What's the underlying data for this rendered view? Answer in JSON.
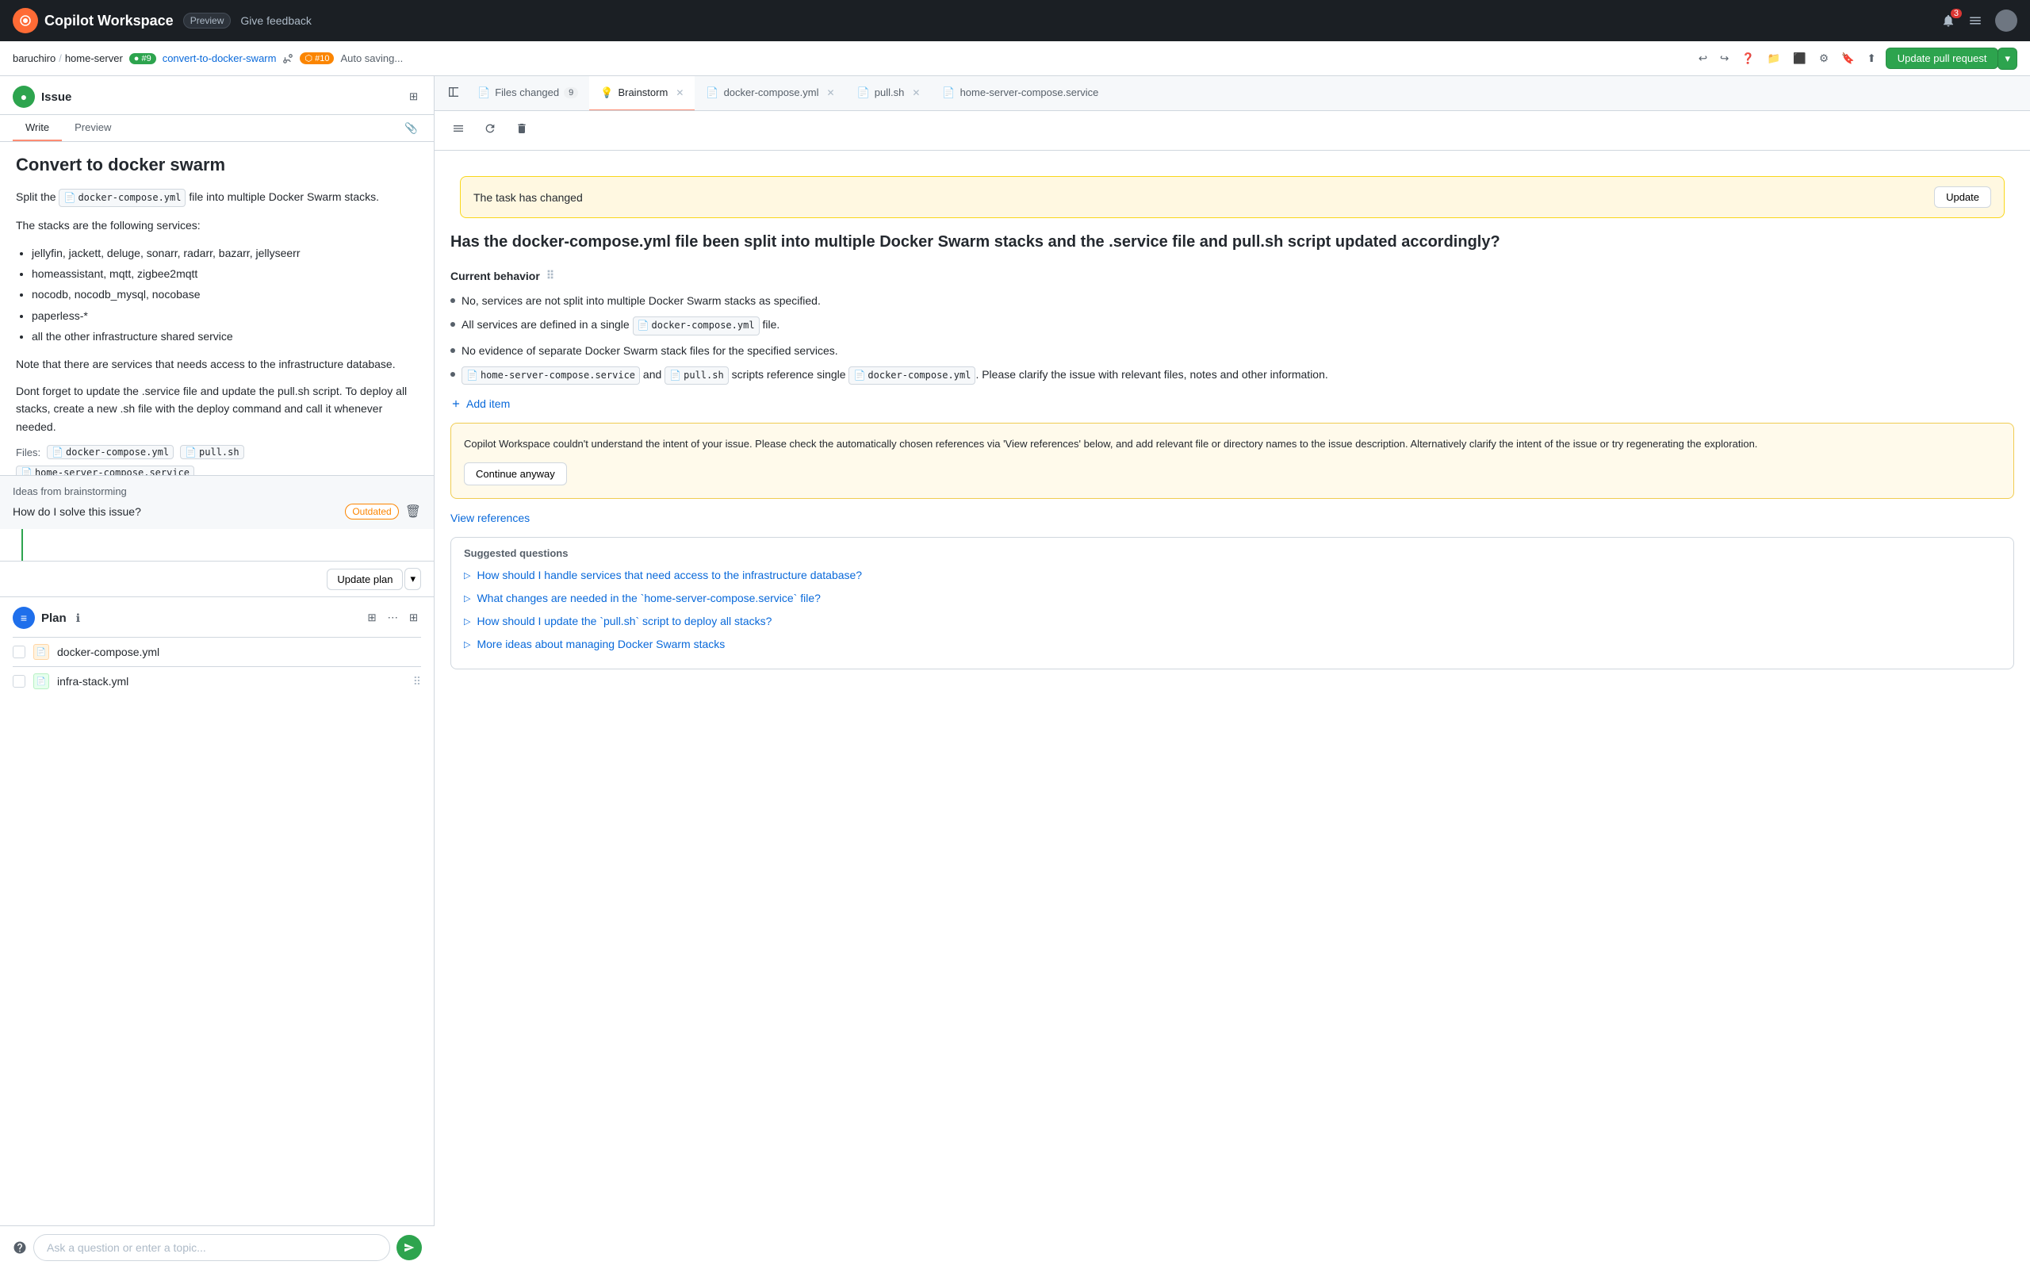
{
  "topNav": {
    "title": "Copilot Workspace",
    "badge": "Preview",
    "feedback": "Give feedback",
    "bellCount": "3",
    "icons": {
      "bell": "🔔",
      "menu": "☰",
      "avatar": ""
    }
  },
  "secondaryNav": {
    "user": "baruchiro",
    "repo": "home-server",
    "issueNum": "#9",
    "branch": "convert-to-docker-swarm",
    "prNum": "#10",
    "autoSaving": "Auto saving...",
    "updatePR": "Update pull request"
  },
  "leftPanel": {
    "issueLabel": "Issue",
    "tabs": {
      "write": "Write",
      "preview": "Preview"
    },
    "issueTitle": "Convert to docker swarm",
    "issueBody": [
      "Split the",
      "docker-compose.yml",
      "file into multiple Docker Swarm stacks.",
      "The stacks are the following services:"
    ],
    "stacksList": [
      "jellyfin, jackett, deluge, sonarr, radarr, bazarr, jellyseerr",
      "homeassistant, mqtt, zigbee2mqtt",
      "nocodb, nocodb_mysql, nocobase",
      "paperless-*",
      "all the other infrastructure shared service"
    ],
    "noteParagraph": "Note that there are services that needs access to the infrastructure database.",
    "deployParagraph": "Dont forget to update the .service file and update the pull.sh script. To deploy all stacks, create a new .sh file with the deploy command and call it whenever needed.",
    "filesLabel": "Files:",
    "files": [
      "docker-compose.yml",
      "pull.sh",
      "home-server-compose.service"
    ],
    "ideasSection": {
      "label": "Ideas from brainstorming",
      "item": "How do I solve this issue?",
      "outdatedBadge": "Outdated"
    },
    "updatePlanBtn": "Update plan",
    "planLabel": "Plan",
    "planItems": [
      {
        "name": "docker-compose.yml",
        "type": "orange",
        "icon": "📄"
      },
      {
        "name": "infra-stack.yml",
        "type": "green",
        "icon": "📄"
      }
    ]
  },
  "askBar": {
    "placeholder": "Ask a question or enter a topic...",
    "sendIcon": "▶"
  },
  "rightPanel": {
    "tabs": [
      {
        "id": "files-changed",
        "label": "Files changed",
        "count": "9",
        "active": false,
        "icon": "📄"
      },
      {
        "id": "brainstorm",
        "label": "Brainstorm",
        "active": true,
        "closeable": true,
        "icon": "💡"
      },
      {
        "id": "docker-compose",
        "label": "docker-compose.yml",
        "active": false,
        "closeable": true,
        "icon": "📄"
      },
      {
        "id": "pull-sh",
        "label": "pull.sh",
        "active": false,
        "closeable": true,
        "icon": "📄"
      },
      {
        "id": "home-server",
        "label": "home-server-compose.service",
        "active": false,
        "icon": "📄"
      }
    ],
    "brainstorm": {
      "taskChangedBanner": "The task has changed",
      "updateBtn": "Update",
      "mainQuestion": "Has the docker-compose.yml file been split into multiple Docker Swarm stacks and the .service file and pull.sh script updated accordingly?",
      "currentBehaviorLabel": "Current behavior",
      "bulletPoints": [
        "No, services are not split into multiple Docker Swarm stacks as specified.",
        "All services are defined in a single",
        "No evidence of separate Docker Swarm stack files for the specified services.",
        "and"
      ],
      "bulletPointsFull": [
        "No, services are not split into multiple Docker Swarm stacks as specified.",
        "All services are defined in a single docker-compose.yml file.",
        "No evidence of separate Docker Swarm stack files for the specified services.",
        "home-server-compose.service and pull.sh scripts reference single docker-compose.yml. Please clarify the issue with relevant files, notes and other information."
      ],
      "addItemLabel": "Add item",
      "warningText": "Copilot Workspace couldn't understand the intent of your issue. Please check the automatically chosen references via 'View references' below, and add relevant file or directory names to the issue description. Alternatively clarify the intent of the issue or try regenerating the exploration.",
      "continueAnywayBtn": "Continue anyway",
      "viewRefsLabel": "View references",
      "suggestedTitle": "Suggested questions",
      "suggestedQuestions": [
        "How should I handle services that need access to the infrastructure database?",
        "What changes are needed in the `home-server-compose.service` file?",
        "How should I update the `pull.sh` script to deploy all stacks?",
        "More ideas about managing Docker Swarm stacks"
      ],
      "codeSnippets": {
        "dockerComposeYml": "docker-compose.yml",
        "pullSh": "pull.sh",
        "homeServerCompose": "home-server-compose.service",
        "dockerComposeYml2": "docker-compose.yml"
      }
    }
  }
}
